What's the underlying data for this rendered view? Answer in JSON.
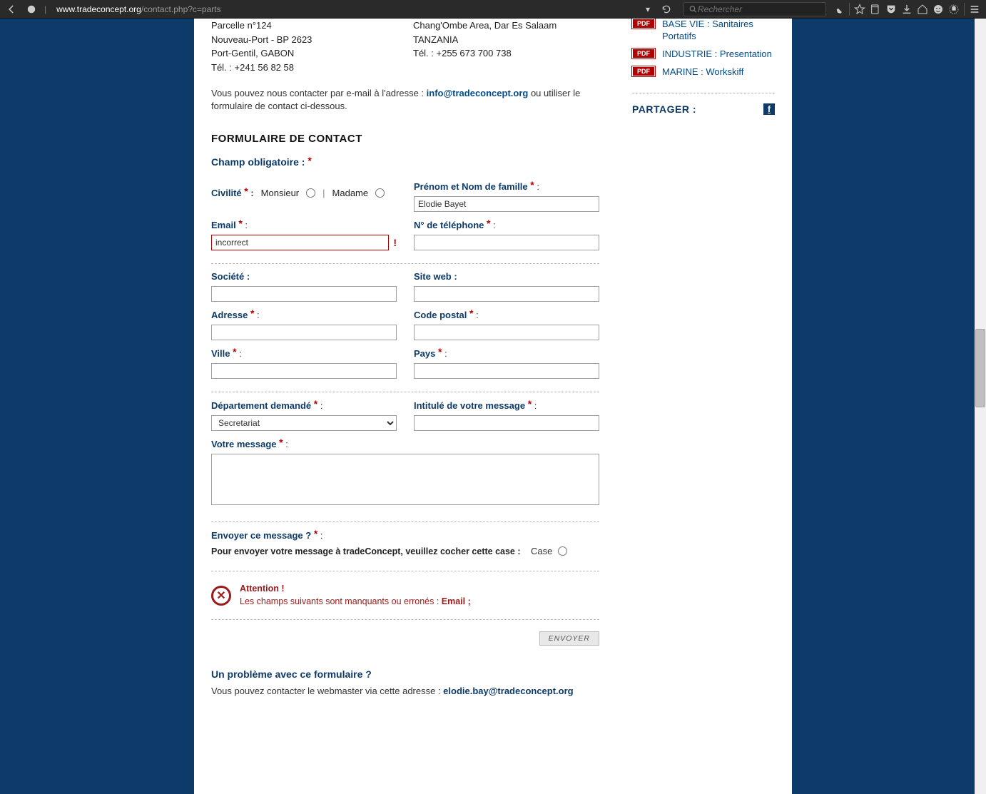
{
  "chrome": {
    "url_host": "www.tradeconcept.org",
    "url_path": "/contact.php?c=parts",
    "search_placeholder": "Rechercher"
  },
  "addr": {
    "left_l1": "Parcelle n°124",
    "left_l2": "Nouveau-Port - BP 2623",
    "left_l3": "Port-Gentil, GABON",
    "left_l4": "Tél. : +241 56 82 58",
    "right_l1": "Chang'Ombe Area, Dar Es Salaam",
    "right_l2": "TANZANIA",
    "right_l3": "Tél. : +255 673 700 738"
  },
  "intro": {
    "pre": "Vous pouvez nous contacter par e-mail à l'adresse : ",
    "email": "info@tradeconcept.org",
    "post": " ou utiliser le formulaire de contact ci-dessous."
  },
  "form": {
    "title": "FORMULAIRE DE CONTACT",
    "oblig": "Champ obligatoire :",
    "civ_label": "Civilité",
    "civ_m": "Monsieur",
    "civ_f": "Madame",
    "name_label": "Prénom et Nom de famille",
    "name_value": "Elodie Bayet",
    "email_label": "Email",
    "email_value": "incorrect",
    "phone_label": "N° de téléphone",
    "company_label": "Société :",
    "website_label": "Site web :",
    "address_label": "Adresse",
    "postal_label": "Code postal",
    "city_label": "Ville",
    "country_label": "Pays",
    "dept_label": "Département demandé",
    "dept_value": "Secretariat",
    "subject_label": "Intitulé de votre message",
    "message_label": "Votre message",
    "send_label": "Envoyer ce message ?",
    "send_inst": "Pour envoyer votre message à tradeConcept, veuillez cocher cette case :",
    "case_label": "Case",
    "alert_title": "Attention !",
    "alert_pre": "Les champs suivants sont manquants ou erronés : ",
    "alert_fields": "Email ;",
    "submit": "ENVOYER"
  },
  "problem": {
    "title": "Un problème avec ce formulaire ?",
    "pre": "Vous pouvez contacter le webmaster via cette adresse : ",
    "email": "elodie.bay@tradeconcept.org"
  },
  "aside": {
    "pdf": "PDF",
    "doc1": "BASE VIE : Sanitaires Portatifs",
    "doc2": "INDUSTRIE : Presentation",
    "doc3": "MARINE : Workskiff",
    "share": "PARTAGER :",
    "fb": "f"
  }
}
